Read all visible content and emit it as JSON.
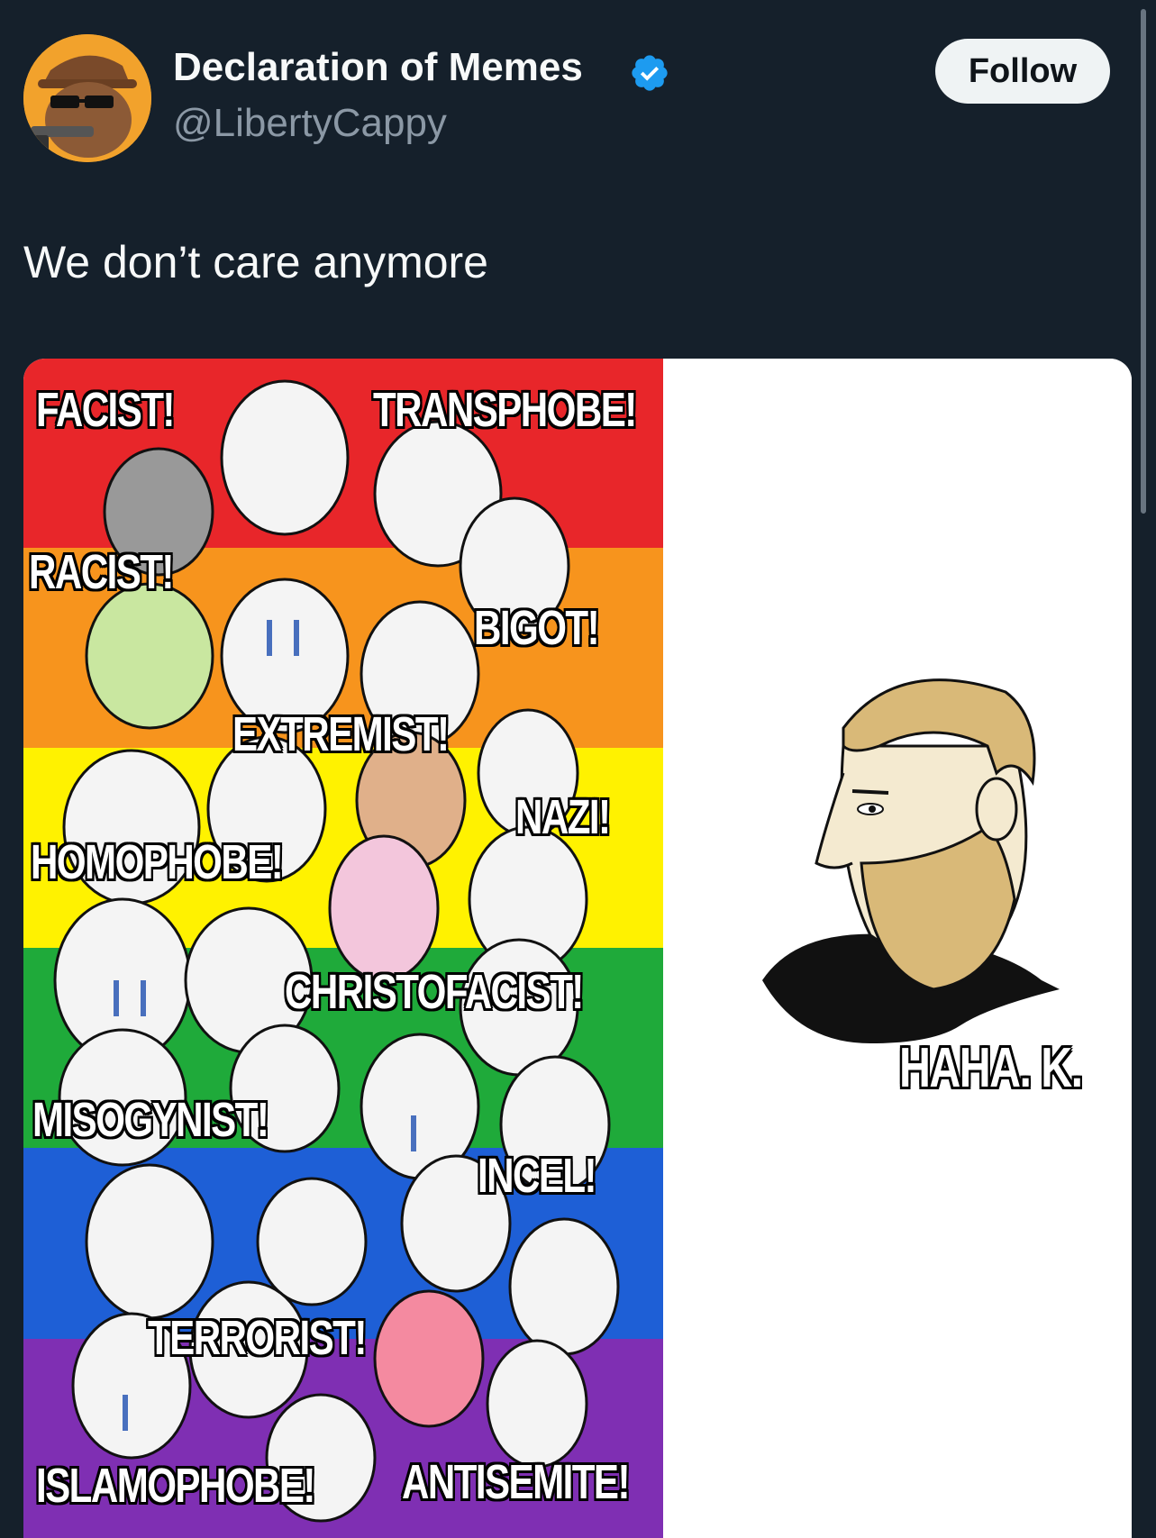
{
  "account": {
    "name": "Declaration of Memes",
    "handle": "@LibertyCappy",
    "verified": true,
    "avatar_icon": "capybara-avatar-icon"
  },
  "follow_button": {
    "label": "Follow"
  },
  "tweet": {
    "text": "We don’t care anymore"
  },
  "meme": {
    "stripe_colors": [
      "#e8262a",
      "#f7941d",
      "#fff200",
      "#1faa3a",
      "#1e5fd6",
      "#7f2fb3"
    ],
    "left_labels": [
      "FACIST!",
      "TRANSPHOBE!",
      "RACIST!",
      "BIGOT!",
      "EXTREMIST!",
      "NAZI!",
      "HOMOPHOBE!",
      "CHRISTOFACIST!",
      "MISOGYNIST!",
      "INCEL!",
      "TERRORIST!",
      "ISLAMOPHOBE!",
      "ANTISEMITE!"
    ],
    "right_label": "HAHA. K."
  },
  "colors": {
    "background": "#15202b",
    "verified": "#1d9bf0"
  }
}
